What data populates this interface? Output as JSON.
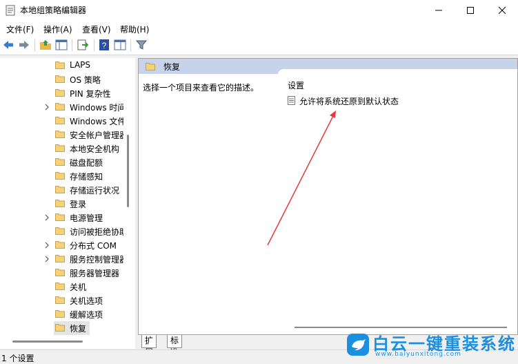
{
  "window": {
    "title": "本地组策略编辑器"
  },
  "menu": [
    "文件(F)",
    "操作(A)",
    "查看(V)",
    "帮助(H)"
  ],
  "tree": [
    {
      "label": "LAPS",
      "expandable": false
    },
    {
      "label": "OS 策略",
      "expandable": false
    },
    {
      "label": "PIN 复杂性",
      "expandable": false
    },
    {
      "label": "Windows 时间",
      "expandable": true
    },
    {
      "label": "Windows 文件",
      "expandable": false
    },
    {
      "label": "安全帐户管理器",
      "expandable": false
    },
    {
      "label": "本地安全机构",
      "expandable": false
    },
    {
      "label": "磁盘配额",
      "expandable": false
    },
    {
      "label": "存储感知",
      "expandable": false
    },
    {
      "label": "存储运行状况",
      "expandable": false
    },
    {
      "label": "登录",
      "expandable": false
    },
    {
      "label": "电源管理",
      "expandable": true
    },
    {
      "label": "访问被拒绝协助",
      "expandable": false
    },
    {
      "label": "分布式 COM",
      "expandable": true
    },
    {
      "label": "服务控制管理器",
      "expandable": true
    },
    {
      "label": "服务器管理器",
      "expandable": false
    },
    {
      "label": "关机",
      "expandable": false
    },
    {
      "label": "关机选项",
      "expandable": false
    },
    {
      "label": "缓解选项",
      "expandable": false
    },
    {
      "label": "恢复",
      "expandable": false,
      "selected": true
    }
  ],
  "content": {
    "header": "恢复",
    "description": "选择一个项目来查看它的描述。",
    "column_header": "设置",
    "settings": [
      "允许将系统还原到默认状态"
    ]
  },
  "tabs": [
    "扩展",
    "标准"
  ],
  "status": "1 个设置",
  "watermark": {
    "text": "白云一键重装系统",
    "url": "www.baiyunxitong.com"
  },
  "colors": {
    "header_band": "#c7d3ea",
    "arrow": "#e53935",
    "watermark": "#1b8fe0"
  }
}
